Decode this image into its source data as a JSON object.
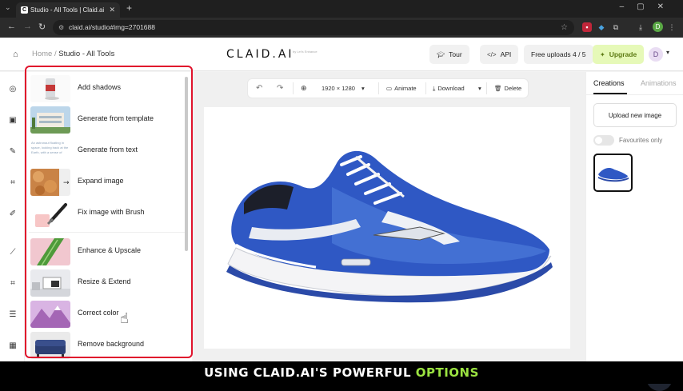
{
  "browser": {
    "tab_title": "Studio - All Tools | Claid.ai",
    "url": "claid.ai/studio#img=2701688",
    "profile_initial": "D"
  },
  "header": {
    "breadcrumb_home": "Home",
    "breadcrumb_sep": "/",
    "breadcrumb_current": "Studio - All Tools",
    "logo": "CLAID.AI",
    "logo_sub": "by Let's Enhance",
    "tour_label": "Tour",
    "api_label": "API",
    "free_uploads": "Free uploads 4 / 5",
    "upgrade_label": "Upgrade",
    "user_initial": "D"
  },
  "tools": [
    {
      "label": "Add shadows",
      "thumb": "can"
    },
    {
      "label": "Generate from template",
      "thumb": "building"
    },
    {
      "label": "Generate from text",
      "thumb": "text"
    },
    {
      "label": "Expand image",
      "thumb": "croissant"
    },
    {
      "label": "Fix image with Brush",
      "thumb": "brush"
    },
    {
      "label": "Enhance & Upscale",
      "thumb": "leaf"
    },
    {
      "label": "Resize & Extend",
      "thumb": "room"
    },
    {
      "label": "Correct color",
      "thumb": "mountain"
    },
    {
      "label": "Remove background",
      "thumb": "sofa"
    }
  ],
  "template_thumb_text": "An astronaut floating in space, looking back at the Earth, with a sense of",
  "toolbar": {
    "size": "1920 × 1280",
    "animate": "Animate",
    "download": "Download",
    "delete": "Delete"
  },
  "right_panel": {
    "tab_creations": "Creations",
    "tab_animations": "Animations",
    "upload_label": "Upload new image",
    "favourites_label": "Favourites only",
    "favourites_on": false
  },
  "caption": {
    "prefix": "USING CLAID.AI'S POWERFUL ",
    "highlight": "OPTIONS"
  },
  "colors": {
    "accent_red": "#e0132c",
    "upgrade_bg": "#e6f9b8",
    "caption_highlight": "#9be341"
  }
}
